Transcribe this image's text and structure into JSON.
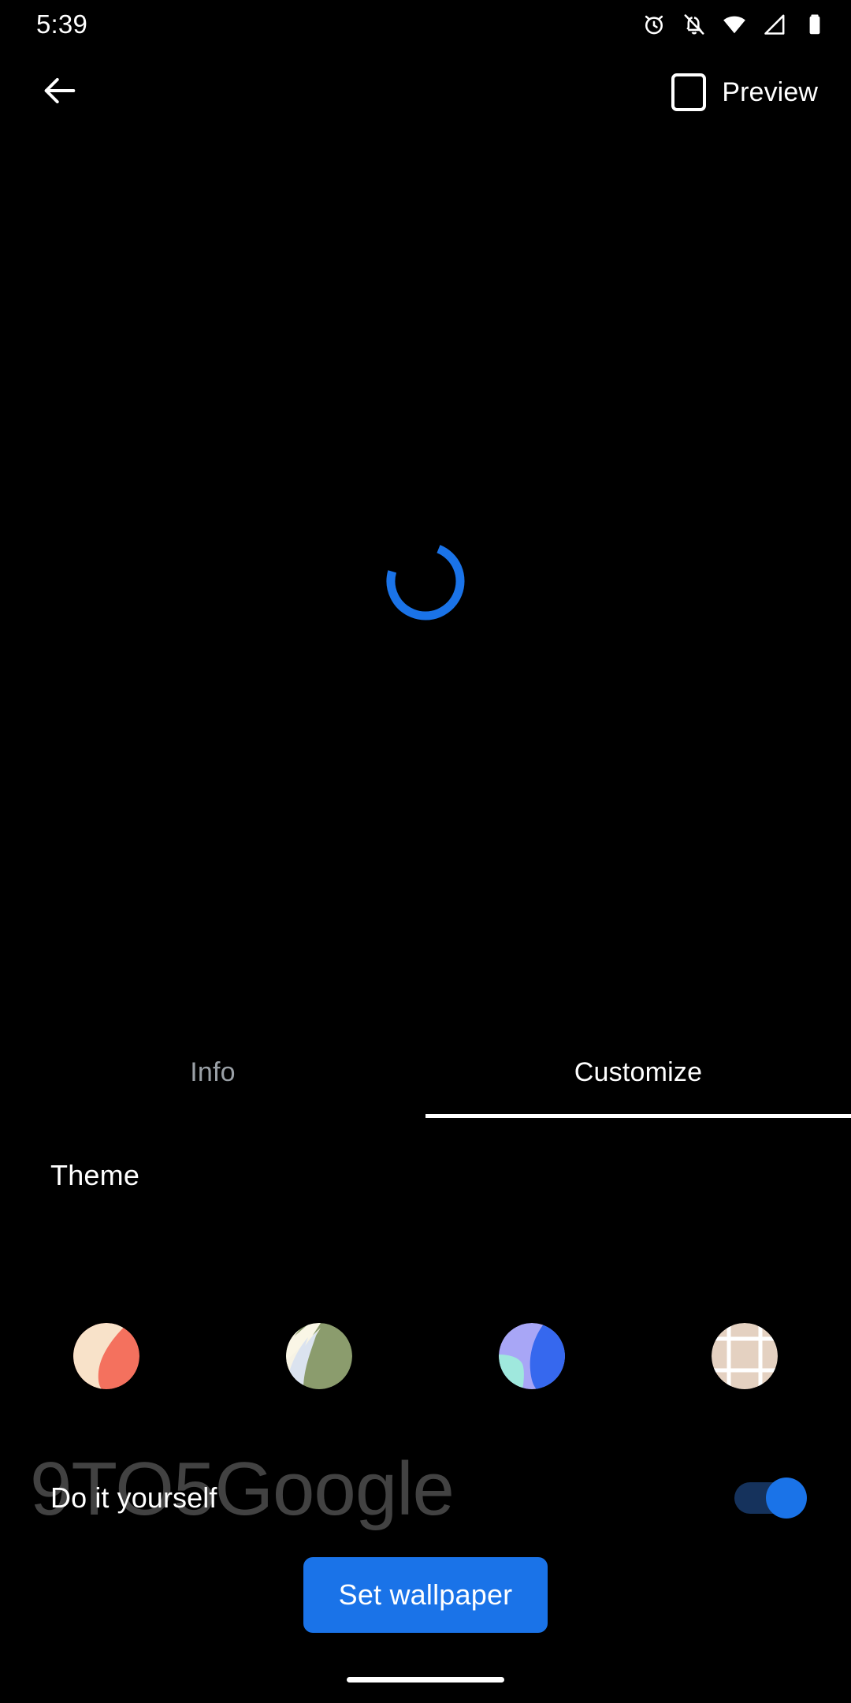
{
  "status_bar": {
    "time": "5:39",
    "icons": [
      {
        "name": "alarm-icon",
        "label": "Alarm set"
      },
      {
        "name": "notifications-off-icon",
        "label": "Notifications silenced"
      },
      {
        "name": "wifi-icon",
        "label": "Wi-Fi connected"
      },
      {
        "name": "cell-signal-icon",
        "label": "Mobile signal"
      },
      {
        "name": "battery-icon",
        "label": "Battery"
      }
    ]
  },
  "app_bar": {
    "back_label": "Back",
    "preview_label": "Preview",
    "preview_icon": "phone-outline-icon"
  },
  "preview": {
    "state": "loading",
    "spinner_color": "#1a73e8"
  },
  "tabs": [
    {
      "label": "Info",
      "active": false
    },
    {
      "label": "Customize",
      "active": true
    }
  ],
  "customize": {
    "theme_section_title": "Theme",
    "themes": [
      {
        "name": "peach-coral-theme",
        "selected": false,
        "colors": {
          "primary": "#f8e2c9",
          "secondary": "#f4715e",
          "tertiary": "#f4715e"
        }
      },
      {
        "name": "sage-green-theme",
        "selected": false,
        "colors": {
          "primary": "#8b9c6d",
          "secondary": "#faf6e6",
          "tertiary": "#dbe3ef"
        }
      },
      {
        "name": "periwinkle-blue-theme",
        "selected": false,
        "colors": {
          "primary": "#a8a6f6",
          "secondary": "#9fe8dd",
          "tertiary": "#3668ee"
        }
      },
      {
        "name": "beige-grid-theme",
        "selected": false,
        "colors": {
          "primary": "#e4d1c1",
          "secondary": "#ffffff",
          "tertiary": "#e4d1c1"
        }
      }
    ],
    "diy": {
      "label": "Do it yourself",
      "enabled": true,
      "toggle_on_color": "#1a73e8",
      "toggle_track_color": "#15325c"
    }
  },
  "footer": {
    "primary_button_label": "Set wallpaper",
    "primary_button_color": "#1a73e8"
  },
  "watermark": {
    "text": "9TO5Google"
  }
}
